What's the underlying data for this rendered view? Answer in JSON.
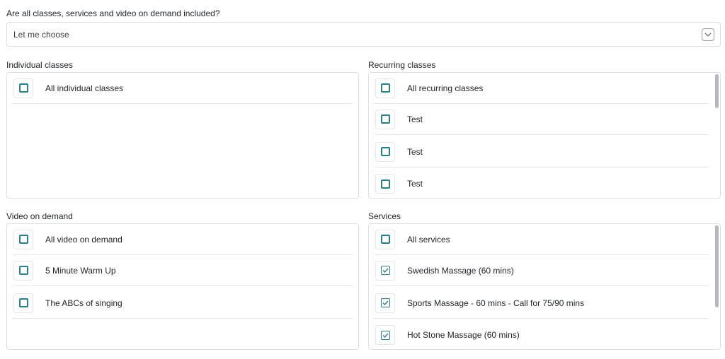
{
  "question": "Are all classes, services and video on demand included?",
  "select": {
    "value": "Let me choose"
  },
  "individual": {
    "title": "Individual classes",
    "items": [
      {
        "label": "All individual classes",
        "checked": false
      }
    ]
  },
  "recurring": {
    "title": "Recurring classes",
    "items": [
      {
        "label": "All recurring classes",
        "checked": false
      },
      {
        "label": "Test",
        "checked": false
      },
      {
        "label": "Test",
        "checked": false
      },
      {
        "label": "Test",
        "checked": false
      }
    ]
  },
  "video": {
    "title": "Video on demand",
    "items": [
      {
        "label": "All video on demand",
        "checked": false
      },
      {
        "label": "5 Minute Warm Up",
        "checked": false
      },
      {
        "label": "The ABCs of singing",
        "checked": false
      }
    ]
  },
  "services": {
    "title": "Services",
    "items": [
      {
        "label": "All services",
        "checked": false
      },
      {
        "label": "Swedish Massage (60 mins)",
        "checked": true
      },
      {
        "label": "Sports Massage - 60 mins - Call for 75/90 mins",
        "checked": true
      },
      {
        "label": "Hot Stone Massage (60 mins)",
        "checked": true
      }
    ]
  },
  "colors": {
    "accent": "#2a7f8a",
    "border": "#dcdfe3"
  }
}
